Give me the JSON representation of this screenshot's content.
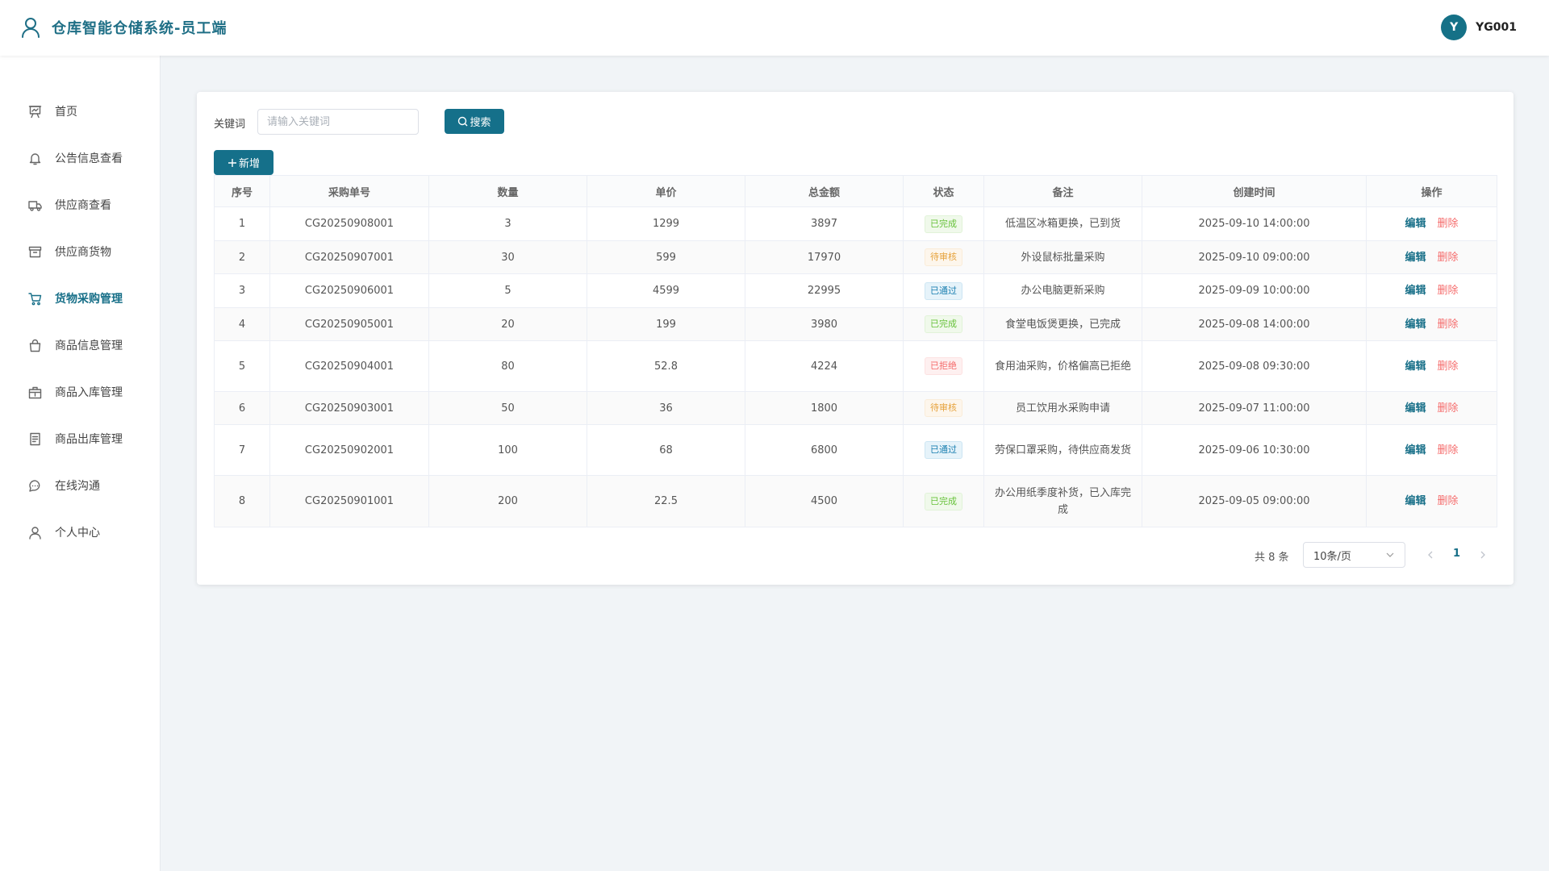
{
  "header": {
    "title": "仓库智能仓储系统-员工端",
    "avatar_letter": "Y",
    "username": "YG001",
    "brand_color": "#15708a"
  },
  "sidebar": {
    "items": [
      {
        "label": "首页",
        "icon": "home-board-icon",
        "active": false
      },
      {
        "label": "公告信息查看",
        "icon": "bell-icon",
        "active": false
      },
      {
        "label": "供应商查看",
        "icon": "truck-icon",
        "active": false
      },
      {
        "label": "供应商货物",
        "icon": "archive-box-icon",
        "active": false
      },
      {
        "label": "货物采购管理",
        "icon": "shopping-cart-icon",
        "active": true
      },
      {
        "label": "商品信息管理",
        "icon": "shopping-bag-icon",
        "active": false
      },
      {
        "label": "商品入库管理",
        "icon": "package-in-icon",
        "active": false
      },
      {
        "label": "商品出库管理",
        "icon": "document-list-icon",
        "active": false
      },
      {
        "label": "在线沟通",
        "icon": "chat-bubble-icon",
        "active": false
      },
      {
        "label": "个人中心",
        "icon": "user-icon",
        "active": false
      }
    ]
  },
  "toolbar": {
    "keyword_label": "关键词",
    "keyword_placeholder": "请输入关键词",
    "keyword_value": "",
    "search_label": "搜索",
    "add_label": "新增"
  },
  "table": {
    "columns": [
      "序号",
      "采购单号",
      "数量",
      "单价",
      "总金额",
      "状态",
      "备注",
      "创建时间",
      "操作"
    ],
    "edit_label": "编辑",
    "delete_label": "删除",
    "rows": [
      {
        "index": "1",
        "order_no": "CG20250908001",
        "qty": "3",
        "price": "1299",
        "total": "3897",
        "status": "已完成",
        "status_type": "done",
        "remark": "低温区冰箱更换，已到货",
        "created": "2025-09-10 14:00:00"
      },
      {
        "index": "2",
        "order_no": "CG20250907001",
        "qty": "30",
        "price": "599",
        "total": "17970",
        "status": "待审核",
        "status_type": "pending",
        "remark": "外设鼠标批量采购",
        "created": "2025-09-10 09:00:00"
      },
      {
        "index": "3",
        "order_no": "CG20250906001",
        "qty": "5",
        "price": "4599",
        "total": "22995",
        "status": "已通过",
        "status_type": "passed",
        "remark": "办公电脑更新采购",
        "created": "2025-09-09 10:00:00"
      },
      {
        "index": "4",
        "order_no": "CG20250905001",
        "qty": "20",
        "price": "199",
        "total": "3980",
        "status": "已完成",
        "status_type": "done",
        "remark": "食堂电饭煲更换，已完成",
        "created": "2025-09-08 14:00:00"
      },
      {
        "index": "5",
        "order_no": "CG20250904001",
        "qty": "80",
        "price": "52.8",
        "total": "4224",
        "status": "已拒绝",
        "status_type": "rejected",
        "remark": "食用油采购，价格偏高已拒绝",
        "created": "2025-09-08 09:30:00"
      },
      {
        "index": "6",
        "order_no": "CG20250903001",
        "qty": "50",
        "price": "36",
        "total": "1800",
        "status": "待审核",
        "status_type": "pending",
        "remark": "员工饮用水采购申请",
        "created": "2025-09-07 11:00:00"
      },
      {
        "index": "7",
        "order_no": "CG20250902001",
        "qty": "100",
        "price": "68",
        "total": "6800",
        "status": "已通过",
        "status_type": "passed",
        "remark": "劳保口罩采购，待供应商发货",
        "created": "2025-09-06 10:30:00"
      },
      {
        "index": "8",
        "order_no": "CG20250901001",
        "qty": "200",
        "price": "22.5",
        "total": "4500",
        "status": "已完成",
        "status_type": "done",
        "remark": "办公用纸季度补货，已入库完成",
        "created": "2025-09-05 09:00:00"
      }
    ]
  },
  "pagination": {
    "total_text": "共 8 条",
    "page_size": "10条/页",
    "current_page": "1"
  }
}
